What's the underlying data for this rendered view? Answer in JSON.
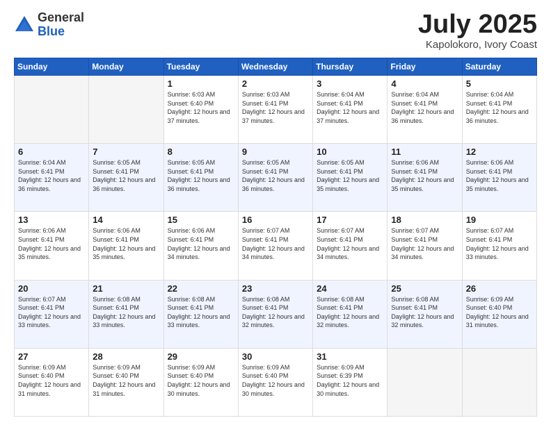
{
  "logo": {
    "general": "General",
    "blue": "Blue"
  },
  "title": {
    "month": "July 2025",
    "location": "Kapolokoro, Ivory Coast"
  },
  "weekdays": [
    "Sunday",
    "Monday",
    "Tuesday",
    "Wednesday",
    "Thursday",
    "Friday",
    "Saturday"
  ],
  "weeks": [
    [
      {
        "day": "",
        "info": ""
      },
      {
        "day": "",
        "info": ""
      },
      {
        "day": "1",
        "info": "Sunrise: 6:03 AM\nSunset: 6:40 PM\nDaylight: 12 hours and 37 minutes."
      },
      {
        "day": "2",
        "info": "Sunrise: 6:03 AM\nSunset: 6:41 PM\nDaylight: 12 hours and 37 minutes."
      },
      {
        "day": "3",
        "info": "Sunrise: 6:04 AM\nSunset: 6:41 PM\nDaylight: 12 hours and 37 minutes."
      },
      {
        "day": "4",
        "info": "Sunrise: 6:04 AM\nSunset: 6:41 PM\nDaylight: 12 hours and 36 minutes."
      },
      {
        "day": "5",
        "info": "Sunrise: 6:04 AM\nSunset: 6:41 PM\nDaylight: 12 hours and 36 minutes."
      }
    ],
    [
      {
        "day": "6",
        "info": "Sunrise: 6:04 AM\nSunset: 6:41 PM\nDaylight: 12 hours and 36 minutes."
      },
      {
        "day": "7",
        "info": "Sunrise: 6:05 AM\nSunset: 6:41 PM\nDaylight: 12 hours and 36 minutes."
      },
      {
        "day": "8",
        "info": "Sunrise: 6:05 AM\nSunset: 6:41 PM\nDaylight: 12 hours and 36 minutes."
      },
      {
        "day": "9",
        "info": "Sunrise: 6:05 AM\nSunset: 6:41 PM\nDaylight: 12 hours and 36 minutes."
      },
      {
        "day": "10",
        "info": "Sunrise: 6:05 AM\nSunset: 6:41 PM\nDaylight: 12 hours and 35 minutes."
      },
      {
        "day": "11",
        "info": "Sunrise: 6:06 AM\nSunset: 6:41 PM\nDaylight: 12 hours and 35 minutes."
      },
      {
        "day": "12",
        "info": "Sunrise: 6:06 AM\nSunset: 6:41 PM\nDaylight: 12 hours and 35 minutes."
      }
    ],
    [
      {
        "day": "13",
        "info": "Sunrise: 6:06 AM\nSunset: 6:41 PM\nDaylight: 12 hours and 35 minutes."
      },
      {
        "day": "14",
        "info": "Sunrise: 6:06 AM\nSunset: 6:41 PM\nDaylight: 12 hours and 35 minutes."
      },
      {
        "day": "15",
        "info": "Sunrise: 6:06 AM\nSunset: 6:41 PM\nDaylight: 12 hours and 34 minutes."
      },
      {
        "day": "16",
        "info": "Sunrise: 6:07 AM\nSunset: 6:41 PM\nDaylight: 12 hours and 34 minutes."
      },
      {
        "day": "17",
        "info": "Sunrise: 6:07 AM\nSunset: 6:41 PM\nDaylight: 12 hours and 34 minutes."
      },
      {
        "day": "18",
        "info": "Sunrise: 6:07 AM\nSunset: 6:41 PM\nDaylight: 12 hours and 34 minutes."
      },
      {
        "day": "19",
        "info": "Sunrise: 6:07 AM\nSunset: 6:41 PM\nDaylight: 12 hours and 33 minutes."
      }
    ],
    [
      {
        "day": "20",
        "info": "Sunrise: 6:07 AM\nSunset: 6:41 PM\nDaylight: 12 hours and 33 minutes."
      },
      {
        "day": "21",
        "info": "Sunrise: 6:08 AM\nSunset: 6:41 PM\nDaylight: 12 hours and 33 minutes."
      },
      {
        "day": "22",
        "info": "Sunrise: 6:08 AM\nSunset: 6:41 PM\nDaylight: 12 hours and 33 minutes."
      },
      {
        "day": "23",
        "info": "Sunrise: 6:08 AM\nSunset: 6:41 PM\nDaylight: 12 hours and 32 minutes."
      },
      {
        "day": "24",
        "info": "Sunrise: 6:08 AM\nSunset: 6:41 PM\nDaylight: 12 hours and 32 minutes."
      },
      {
        "day": "25",
        "info": "Sunrise: 6:08 AM\nSunset: 6:41 PM\nDaylight: 12 hours and 32 minutes."
      },
      {
        "day": "26",
        "info": "Sunrise: 6:09 AM\nSunset: 6:40 PM\nDaylight: 12 hours and 31 minutes."
      }
    ],
    [
      {
        "day": "27",
        "info": "Sunrise: 6:09 AM\nSunset: 6:40 PM\nDaylight: 12 hours and 31 minutes."
      },
      {
        "day": "28",
        "info": "Sunrise: 6:09 AM\nSunset: 6:40 PM\nDaylight: 12 hours and 31 minutes."
      },
      {
        "day": "29",
        "info": "Sunrise: 6:09 AM\nSunset: 6:40 PM\nDaylight: 12 hours and 30 minutes."
      },
      {
        "day": "30",
        "info": "Sunrise: 6:09 AM\nSunset: 6:40 PM\nDaylight: 12 hours and 30 minutes."
      },
      {
        "day": "31",
        "info": "Sunrise: 6:09 AM\nSunset: 6:39 PM\nDaylight: 12 hours and 30 minutes."
      },
      {
        "day": "",
        "info": ""
      },
      {
        "day": "",
        "info": ""
      }
    ]
  ]
}
